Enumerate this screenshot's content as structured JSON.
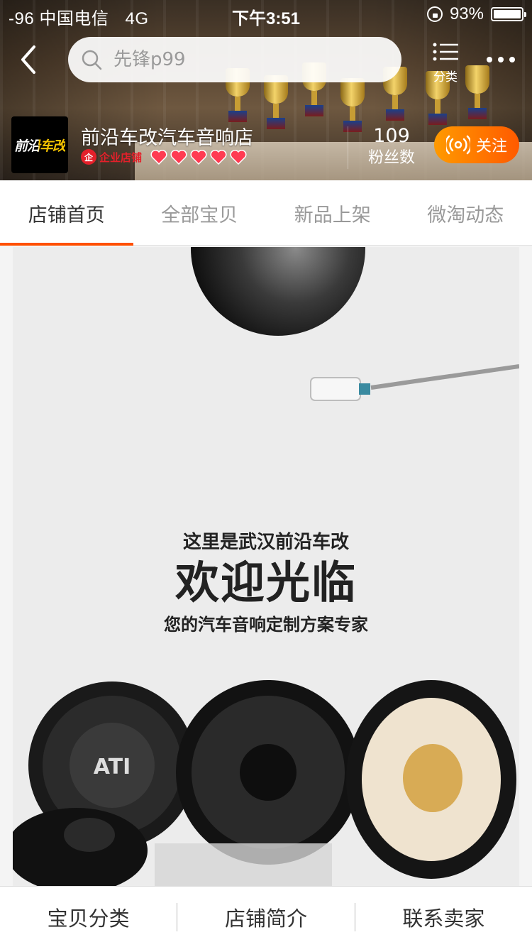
{
  "status_bar": {
    "carrier": "-96 中国电信",
    "network": "4G",
    "time": "下午3:51",
    "battery": "93%"
  },
  "search": {
    "placeholder": "先锋p99"
  },
  "nav": {
    "category_label": "分类"
  },
  "shop": {
    "logo_text": "前沿车改",
    "name": "前沿车改汽车音响店",
    "badge_icon": "企",
    "badge_label": "企业店铺",
    "hearts": 5,
    "fans_count": "109",
    "fans_label": "粉丝数",
    "follow_label": "关注"
  },
  "tabs": [
    {
      "label": "店铺首页",
      "active": true
    },
    {
      "label": "全部宝贝",
      "active": false
    },
    {
      "label": "新品上架",
      "active": false
    },
    {
      "label": "微淘动态",
      "active": false
    }
  ],
  "banner": {
    "line1": "这里是武汉前沿车改",
    "line2": "欢迎光临",
    "line3": "您的汽车音响定制方案专家",
    "speaker_brand": "ATI"
  },
  "bottom_bar": [
    {
      "label": "宝贝分类"
    },
    {
      "label": "店铺简介"
    },
    {
      "label": "联系卖家"
    }
  ],
  "colors": {
    "accent": "#ff5000",
    "follow_gradient_start": "#ff9a00",
    "enterprise_red": "#e4202a"
  }
}
